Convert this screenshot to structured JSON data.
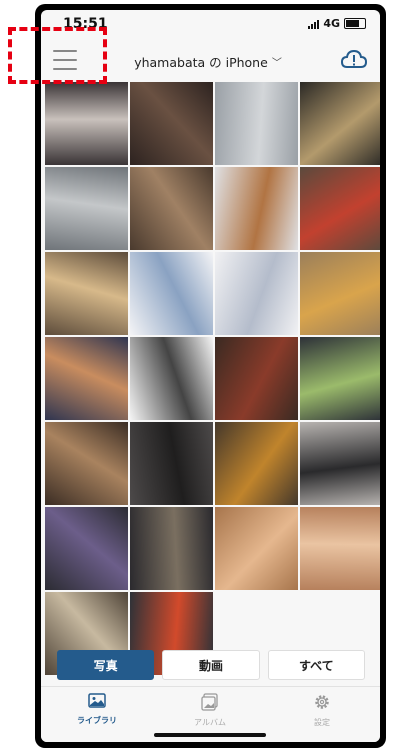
{
  "status_bar": {
    "time": "15:51",
    "network": "4G"
  },
  "nav": {
    "device_name": "yhamabata の iPhone",
    "chevron": "﹀"
  },
  "tabs": {
    "photos": "写真",
    "videos": "動画",
    "all": "すべて"
  },
  "bottom_nav": {
    "library": "ライブラリ",
    "album": "アルバム",
    "settings": "設定"
  },
  "icons": {
    "menu": "hamburger-menu-icon",
    "cloud": "cloud-alert-icon",
    "library": "photo-library-icon",
    "album": "album-icon",
    "settings": "gear-icon"
  },
  "colors": {
    "accent": "#245b8c",
    "highlight": "#e60012"
  },
  "photos": [
    {
      "a": "#3a3436",
      "b": "#c9c1bc"
    },
    {
      "a": "#2d2320",
      "b": "#6a5142"
    },
    {
      "a": "#9aa0a6",
      "b": "#d3d6d9"
    },
    {
      "a": "#2c2a26",
      "b": "#b39a6c"
    },
    {
      "a": "#6f7479",
      "b": "#c4c7c9"
    },
    {
      "a": "#4a3a2e",
      "b": "#a08164"
    },
    {
      "a": "#dfe0e3",
      "b": "#b17443"
    },
    {
      "a": "#5b4a3d",
      "b": "#c2412f"
    },
    {
      "a": "#5d4c3b",
      "b": "#d7b98a"
    },
    {
      "a": "#f4f4f6",
      "b": "#8aa2c2"
    },
    {
      "a": "#f1f1f3",
      "b": "#b4bccb"
    },
    {
      "a": "#9b7f5a",
      "b": "#d9a44c"
    },
    {
      "a": "#2f3550",
      "b": "#c98d5f"
    },
    {
      "a": "#f5f5f5",
      "b": "#444444"
    },
    {
      "a": "#3a2a22",
      "b": "#8a3b2a"
    },
    {
      "a": "#2d3138",
      "b": "#9bbb6b"
    },
    {
      "a": "#3b2d24",
      "b": "#a9835f"
    },
    {
      "a": "#4d4a4a",
      "b": "#1f1e1e"
    },
    {
      "a": "#45382b",
      "b": "#c0842c"
    },
    {
      "a": "#b7b3b0",
      "b": "#2a2a2c"
    },
    {
      "a": "#2c2c33",
      "b": "#6c5e8a"
    },
    {
      "a": "#2b2a2e",
      "b": "#7a6f60"
    },
    {
      "a": "#a7754c",
      "b": "#e5b78e"
    },
    {
      "a": "#b6805c",
      "b": "#eac4a2"
    },
    {
      "a": "#4f4438",
      "b": "#c7b9a0"
    },
    {
      "a": "#2e3238",
      "b": "#d24a2b"
    }
  ]
}
